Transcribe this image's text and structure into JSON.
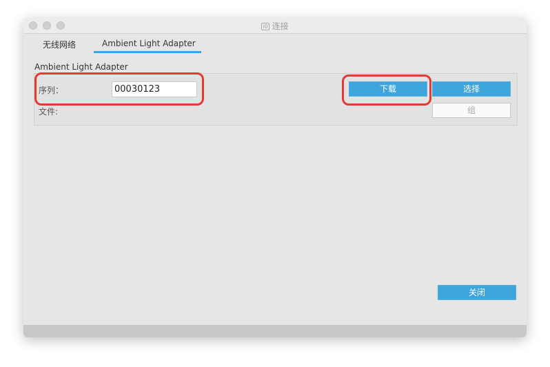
{
  "window": {
    "title": "连接",
    "title_icon": "app-icon"
  },
  "tabs": [
    {
      "label": "无线网络"
    },
    {
      "label": "Ambient Light Adapter",
      "active": true
    }
  ],
  "section_title": "Ambient Light Adapter",
  "form": {
    "serial_label": "序列：",
    "serial_value": "00030123",
    "file_label": "文件:"
  },
  "buttons": {
    "download": "下载",
    "select": "选择",
    "group": "组",
    "close": "关闭"
  },
  "colors": {
    "accent": "#3ea5dc",
    "highlight": "#e53935"
  }
}
